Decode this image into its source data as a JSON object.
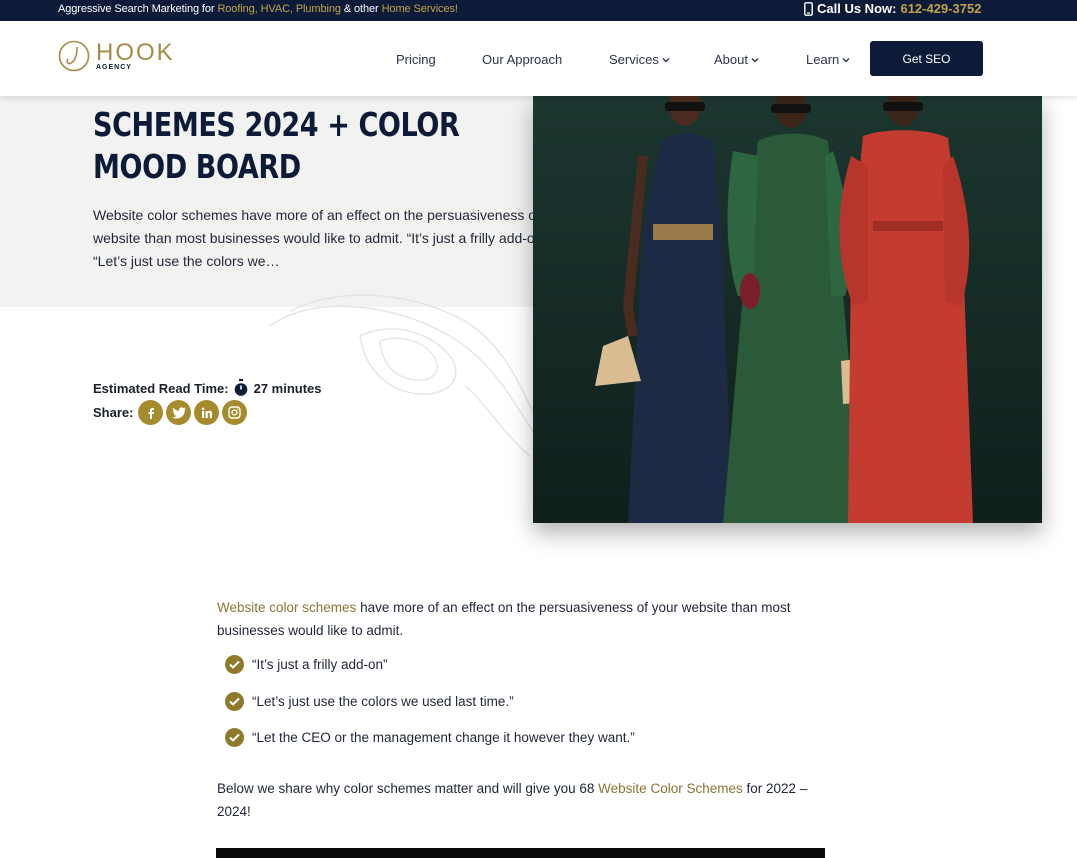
{
  "topbar": {
    "tagline_prefix": "Aggressive Search Marketing for ",
    "tagline_services": "Roofing, HVAC, Plumbing",
    "tagline_mid": " & other ",
    "tagline_home": "Home Services!",
    "call_label": "Call Us Now:",
    "phone": "612-429-3752"
  },
  "header": {
    "logo_name": "HOOK",
    "logo_sub": "AGENCY",
    "nav": [
      "Pricing",
      "Our Approach",
      "Services",
      "About",
      "Learn"
    ],
    "cta": "Get SEO"
  },
  "hero": {
    "title": "SCHEMES 2024 + COLOR MOOD BOARD",
    "excerpt": "Website color schemes have more of an effect on the persuasiveness of your website than most businesses would like to admit. “It’s just a frilly add-on” “Let’s just use the colors we…",
    "read_time_label": "Estimated Read Time:",
    "read_time_value": "27 minutes",
    "share_label": "Share:",
    "share_icons": [
      "facebook-icon",
      "twitter-icon",
      "linkedin-icon",
      "instagram-icon"
    ]
  },
  "article": {
    "intro_link": "Website color schemes",
    "intro_rest": " have more of an effect on the persuasiveness of your website than most businesses would like to admit.",
    "checklist": [
      "“It’s just a frilly add-on”",
      "“Let’s just use the colors we used last time.”",
      "“Let the CEO or the management change it however they want.”"
    ],
    "para2_prefix": "Below we share why color schemes matter and will give you 68 ",
    "para2_link": "Website Color Schemes",
    "para2_suffix": " for 2022 – 2024!"
  },
  "colors": {
    "navy": "#0d1b38",
    "gold": "#c2a24c",
    "gold_dark": "#8c7433",
    "hero_bg": "#f2f2f1"
  }
}
